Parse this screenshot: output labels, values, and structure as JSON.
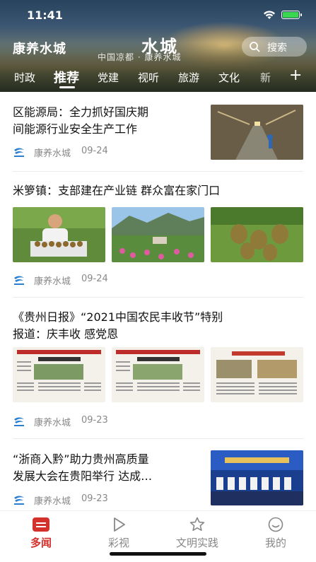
{
  "status_bar": {
    "time": "11:41"
  },
  "header": {
    "app_title": "康养水城",
    "banner_title": "水城",
    "banner_subtitle": "中国凉都 · 康养水城",
    "search_placeholder": "搜索"
  },
  "tabs": [
    {
      "label": "时政",
      "active": false
    },
    {
      "label": "推荐",
      "active": true
    },
    {
      "label": "党建",
      "active": false
    },
    {
      "label": "视听",
      "active": false
    },
    {
      "label": "旅游",
      "active": false
    },
    {
      "label": "文化",
      "active": false
    },
    {
      "label": "新",
      "active": false
    }
  ],
  "articles": [
    {
      "title_line1": "区能源局：全力抓好国庆期",
      "title_line2": "间能源行业安全生产工作",
      "source": "康养水城",
      "date": "09-24",
      "images": [
        "mine-tunnel-photo"
      ]
    },
    {
      "title_line1": "米箩镇：支部建在产业链 群众富在家门口",
      "source": "康养水城",
      "date": "09-24",
      "images": [
        "farmer-kiwi-photo",
        "flower-garden-photo",
        "kiwi-fruit-photo"
      ]
    },
    {
      "title_line1": "《贵州日报》“2021中国农民丰收节”特别",
      "title_line2": "报道：庆丰收 感党恩",
      "source": "康养水城",
      "date": "09-23",
      "images": [
        "newspaper-page-1",
        "newspaper-page-2",
        "newspaper-page-3"
      ]
    },
    {
      "title_line1": "“浙商入黔”助力贵州高质量",
      "title_line2": "发展大会在贵阳举行 达成…",
      "source": "康养水城",
      "date": "09-23",
      "images": [
        "conference-stage-photo"
      ]
    }
  ],
  "bottom_nav": [
    {
      "label": "多闻",
      "icon": "news-icon",
      "active": true
    },
    {
      "label": "彩视",
      "icon": "play-icon",
      "active": false
    },
    {
      "label": "文明实践",
      "icon": "star-icon",
      "active": false
    },
    {
      "label": "我的",
      "icon": "smile-icon",
      "active": false
    }
  ],
  "colors": {
    "accent": "#d4302c",
    "text": "#111111",
    "meta": "#888888"
  }
}
